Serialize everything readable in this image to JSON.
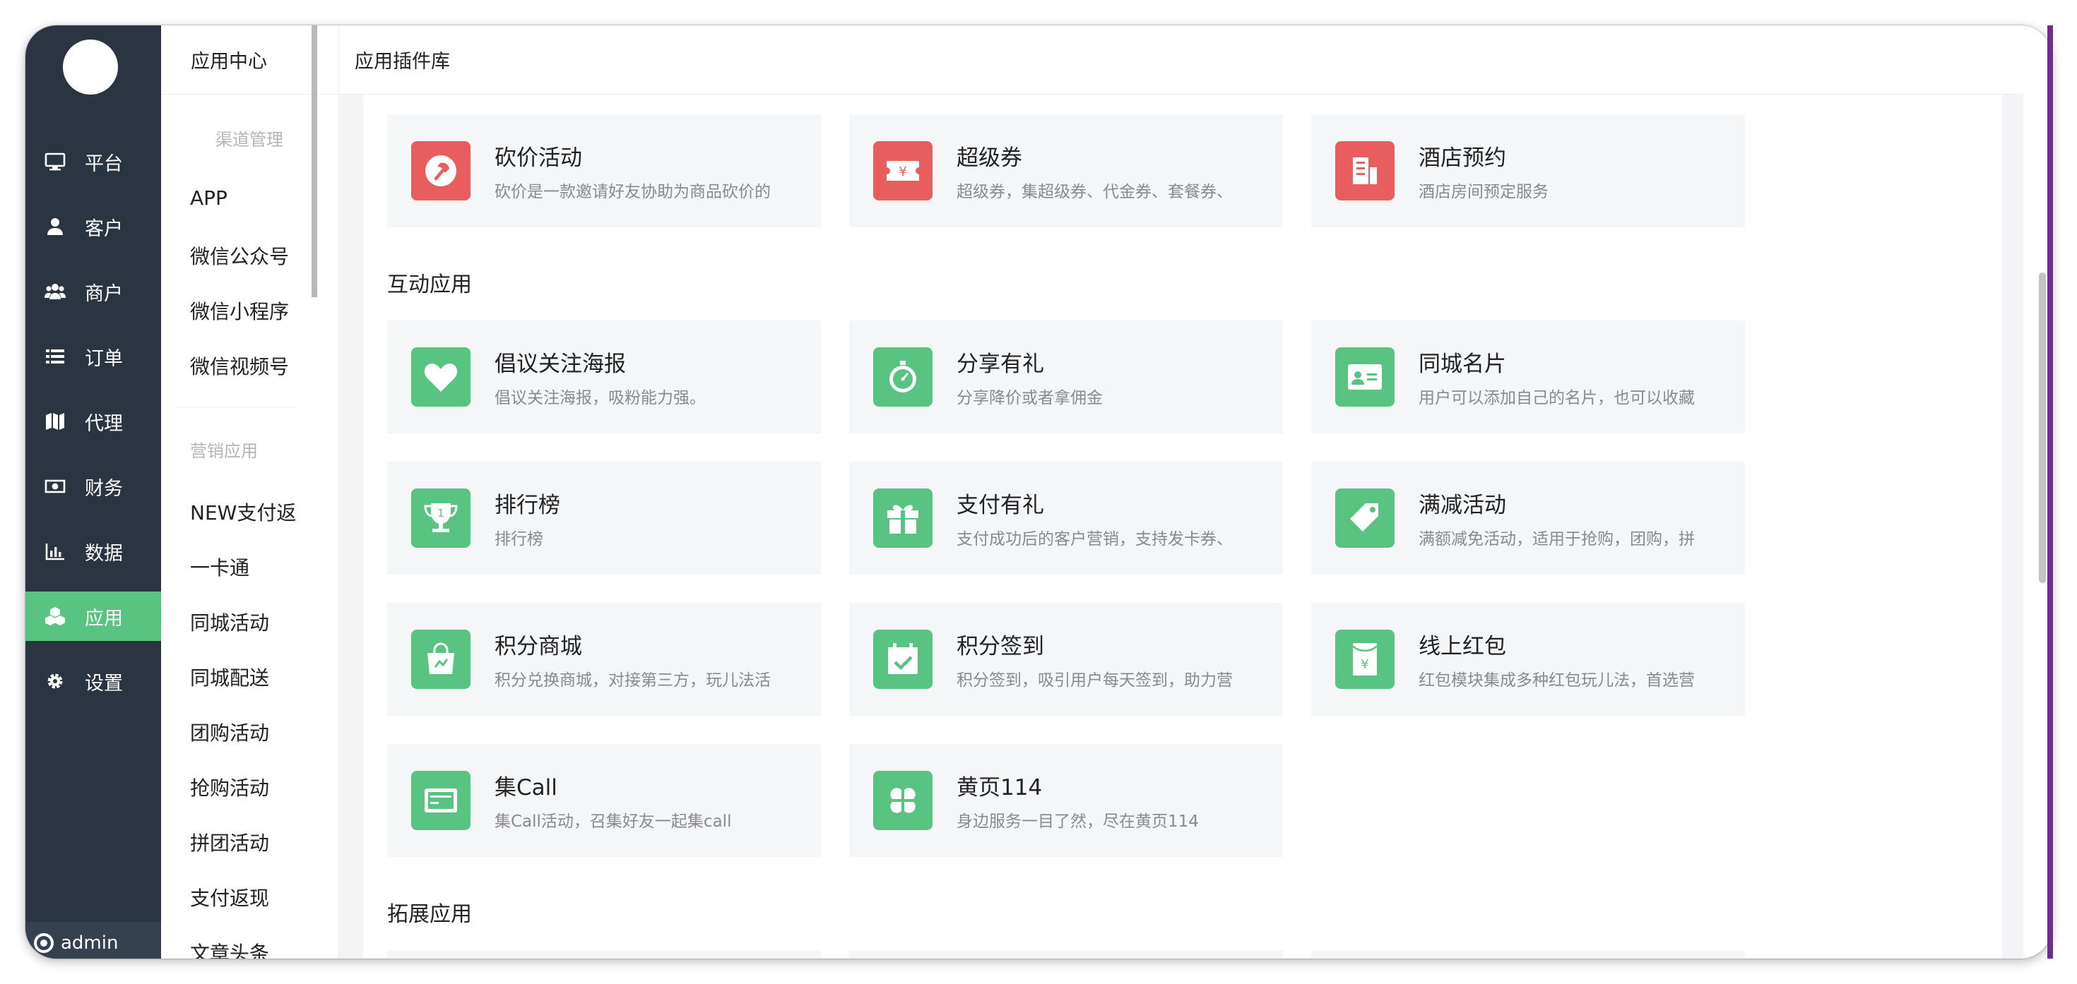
{
  "nav": {
    "items": [
      {
        "label": "平台",
        "icon": "monitor-icon"
      },
      {
        "label": "客户",
        "icon": "user-icon"
      },
      {
        "label": "商户",
        "icon": "users-icon"
      },
      {
        "label": "订单",
        "icon": "list-icon"
      },
      {
        "label": "代理",
        "icon": "map-icon"
      },
      {
        "label": "财务",
        "icon": "money-icon"
      },
      {
        "label": "数据",
        "icon": "bar-chart-icon"
      },
      {
        "label": "应用",
        "icon": "cubes-icon",
        "active": true
      },
      {
        "label": "设置",
        "icon": "gear-icon"
      }
    ],
    "footer_user": "admin"
  },
  "subnav": {
    "title": "应用中心",
    "group1_head": "渠道管理",
    "group1": [
      "APP",
      "微信公众号",
      "微信小程序",
      "微信视频号"
    ],
    "group2_head": "营销应用",
    "group2": [
      "NEW支付返",
      "一卡通",
      "同城活动",
      "同城配送",
      "团购活动",
      "抢购活动",
      "拼团活动",
      "支付返现",
      "文章头条"
    ]
  },
  "topbar": {
    "title": "应用插件库"
  },
  "colors": {
    "accent": "#59c381",
    "red": "#e85e5e",
    "nav_bg": "#2b3541"
  },
  "sections": {
    "top_cards": [
      {
        "title": "砍价活动",
        "desc": "砍价是一款邀请好友协助为商品砍价的",
        "icon": "axe-icon",
        "color": "red"
      },
      {
        "title": "超级券",
        "desc": "超级券，集超级券、代金券、套餐券、",
        "icon": "ticket-icon",
        "color": "red"
      },
      {
        "title": "酒店预约",
        "desc": "酒店房间预定服务",
        "icon": "hotel-icon",
        "color": "red"
      }
    ],
    "interactive_title": "互动应用",
    "interactive_cards": [
      {
        "title": "倡议关注海报",
        "desc": "倡议关注海报，吸粉能力强。",
        "icon": "heart-icon"
      },
      {
        "title": "分享有礼",
        "desc": "分享降价或者拿佣金",
        "icon": "stopwatch-icon"
      },
      {
        "title": "同城名片",
        "desc": "用户可以添加自己的名片，也可以收藏",
        "icon": "id-card-icon"
      },
      {
        "title": "排行榜",
        "desc": "排行榜",
        "icon": "trophy-icon"
      },
      {
        "title": "支付有礼",
        "desc": "支付成功后的客户营销，支持发卡券、",
        "icon": "gift-icon"
      },
      {
        "title": "满减活动",
        "desc": "满额减免活动，适用于抢购，团购，拼",
        "icon": "tag-icon"
      },
      {
        "title": "积分商城",
        "desc": "积分兑换商城，对接第三方，玩儿法活",
        "icon": "shopping-bag-icon"
      },
      {
        "title": "积分签到",
        "desc": "积分签到，吸引用户每天签到，助力营",
        "icon": "calendar-check-icon"
      },
      {
        "title": "线上红包",
        "desc": "红包模块集成多种红包玩儿法，首选营",
        "icon": "red-envelope-icon"
      },
      {
        "title": "集Call",
        "desc": "集Call活动，召集好友一起集call",
        "icon": "card-icon"
      },
      {
        "title": "黄页114",
        "desc": "身边服务一目了然，尽在黄页114",
        "icon": "clover-icon"
      }
    ],
    "extension_title": "拓展应用"
  }
}
